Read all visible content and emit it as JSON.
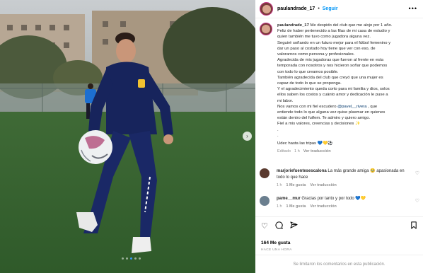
{
  "post": {
    "username": "paulandrade_17",
    "separator": "•",
    "follow_label": "Seguir",
    "more_icon": "more-horizontal-icon",
    "carousel_next_icon": "chevron-right-icon"
  },
  "caption": {
    "username": "paulandrade_17",
    "lines": [
      "Me despido del club que me alojo por 1 año.",
      "Feliz de haber pertenecido a las filas de mi casa de estudio y",
      "quien también me tuvo como jugadora alguna vez.",
      "Seguiré soñando en un futuro mejor para el fútbol femenino y",
      "dar un paso al costado hoy tiene que ver con eso, de",
      "valorarnos como persona y profesionales.",
      "Agradecida de mis jugadoras que fueron al frente en esta",
      "temporada con nosotros y nos hicieron soñar que podemos",
      "con todo lo que creamos posible.",
      "También agradecida del club que creyó que una mujer es",
      "capaz de todo lo que se proponga.",
      "Y el agradecimiento queda corto para mi familia y dios, solos",
      "ellos saben los costos y cuánto amor y dedicación le puse a",
      "mi labor.",
      "Nos vamos con mi fiel escudero ",
      "entiende todo lo que alguna vez quise plasmar en quienes",
      "están dentro del futfem. Te admiro y quiero amigo.",
      "Fiel a mis valores, creencias y decisiones ✨",
      ".",
      ".",
      "Udec hasta las tripas 💙💛⚽"
    ],
    "mention": "@pavel__rivera",
    "mention_suffix": " , que",
    "edited_label": "Editado",
    "time": "1 h",
    "translate": "Ver traducción"
  },
  "comments": [
    {
      "username": "marjoriefuentesescalona",
      "text": "La más grande amiga 🥹 apasionada en todo lo que hace",
      "time": "1 h",
      "likes": "1 Me gusta",
      "translate": "Ver traducción",
      "avatar_color": "#5a3a2e"
    },
    {
      "username": "pame__mur",
      "text": "Gracias por tanto y por todo 💙💛",
      "time": "1 h",
      "likes": "1 Me gusta",
      "translate": "Ver traducción",
      "avatar_color": "#6b7f8f"
    }
  ],
  "actions": {
    "like_icon": "heart-icon",
    "comment_icon": "comment-icon",
    "share_icon": "send-icon",
    "save_icon": "bookmark-icon",
    "likes_count": "164 Me gusta",
    "posted_time": "HACE UNA HORA"
  },
  "footer": {
    "comments_limited": "Se limitaron los comentarios en esta publicación."
  },
  "colors": {
    "follow": "#0095f6",
    "mention": "#00376b",
    "muted": "#8e8e8e",
    "carousel_active_dot": "#3897f0"
  },
  "carousel": {
    "slide_count": 5,
    "active_index": 2
  }
}
